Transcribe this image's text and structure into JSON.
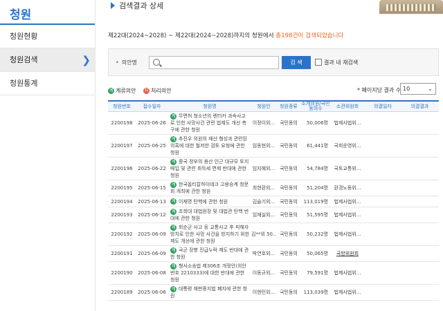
{
  "sidebar": {
    "title": "청원",
    "items": [
      {
        "label": "청원현황",
        "active": false
      },
      {
        "label": "청원검색",
        "active": true
      },
      {
        "label": "청원통계",
        "active": false
      }
    ]
  },
  "header": {
    "title": "검색결과 상세"
  },
  "summary": {
    "prefix": "제22대(2024~2028) ~ 제22대(2024~2028)까지의 청원에서 ",
    "count": "총198건이 검색되었습니다"
  },
  "search": {
    "label": "의안명",
    "value": "",
    "button": "검 색",
    "checkbox_label": "결과 내 재검색"
  },
  "legend": {
    "in_progress": "계류의안",
    "processed": "처리의안",
    "in_progress_icon": "계",
    "processed_icon": "처"
  },
  "perpage": {
    "label": "페이지당 결과 수",
    "value": "10"
  },
  "colors": {
    "accent": "#2c73c8",
    "count_highlight": "#e8641e",
    "pending_icon": "#2e9f5e",
    "processed_icon": "#e85b4a"
  },
  "table": {
    "headers": [
      "청원번호",
      "접수일자",
      "청원명",
      "청원인",
      "청원종류",
      "소개의원/국민동의수",
      "소관위원회",
      "의결일자",
      "의결결과"
    ],
    "rows": [
      {
        "no": "2200198",
        "date": "2025-06-26",
        "title": "무면허 청소년의 렌터카 과속사고로 인한 사망사건 관련 법제도 개선 촉구에 관한 청원",
        "petitioner": "이정이외...",
        "type": "국민동의",
        "agree": "50,006명",
        "committee": "법제사법위...",
        "decision_date": "",
        "result": ""
      },
      {
        "no": "2200197",
        "date": "2025-06-25",
        "title": "추진우 의원의 재산 형성과 관련된 의혹에 대한 철저한 검토 요청에 관한 청원",
        "petitioner": "임동현외...",
        "type": "국민동의",
        "agree": "61,441명",
        "committee": "국회운영위...",
        "decision_date": "",
        "result": ""
      },
      {
        "no": "2200196",
        "date": "2025-06-22",
        "title": "중국 정부의 용산 인근 대규모 토지 매입 및 관련 취득세 면제 반대에 관한 청원",
        "petitioner": "임지혜외...",
        "type": "국민동의",
        "agree": "54,784명",
        "committee": "국토교통위...",
        "decision_date": "",
        "result": ""
      },
      {
        "no": "2200195",
        "date": "2025-06-15",
        "title": "한국옵티칼하이테크 고용승계 청문회 개최에 관한 청원",
        "petitioner": "최현환외...",
        "type": "국민동의",
        "agree": "51,204명",
        "committee": "환경노동위...",
        "decision_date": "",
        "result": ""
      },
      {
        "no": "2200194",
        "date": "2025-06-13",
        "title": "이재명 탄핵에 관한 청원",
        "petitioner": "김슬기외...",
        "type": "국민동의",
        "agree": "113,019명",
        "committee": "법제사법위...",
        "decision_date": "",
        "result": ""
      },
      {
        "no": "2200193",
        "date": "2025-06-12",
        "title": "조희대 대법원장 및 대법관 탄핵 반대에 관한 청원",
        "petitioner": "임재실외...",
        "type": "국민동의",
        "agree": "51,595명",
        "committee": "법제사법위...",
        "decision_date": "",
        "result": ""
      },
      {
        "no": "2200192",
        "date": "2025-06-09",
        "title": "회순군 사고 등 교통사고 후 피해자 방치로 인한 사망 사건을 방지하기 위한 제도 개선에 관한 청원",
        "petitioner": "김**외 50...",
        "type": "국민동의",
        "agree": "50,232명",
        "committee": "법제사법위...",
        "decision_date": "",
        "result": ""
      },
      {
        "no": "2200191",
        "date": "2025-06-09",
        "title": "국군 장병 진급누락 제도 반대에 관한 청원",
        "petitioner": "박연호외...",
        "type": "국민동의",
        "agree": "50,065명",
        "committee": "국방위원회",
        "decision_date": "",
        "result": "",
        "committee_link": true
      },
      {
        "no": "2200190",
        "date": "2025-06-08",
        "title": "형사소송법 제306조 개정안(의안번호 2210333)에 대한 반대에 관한 청원",
        "petitioner": "이동규외...",
        "type": "국민동의",
        "agree": "79,591명",
        "committee": "법제사법위...",
        "decision_date": "",
        "result": ""
      },
      {
        "no": "2200189",
        "date": "2025-06-06",
        "title": "대통령 재판중지법 폐지에 관한 청원",
        "petitioner": "이현민외...",
        "type": "국민동의",
        "agree": "113,039명",
        "committee": "법제사법위...",
        "decision_date": "",
        "result": ""
      }
    ]
  }
}
